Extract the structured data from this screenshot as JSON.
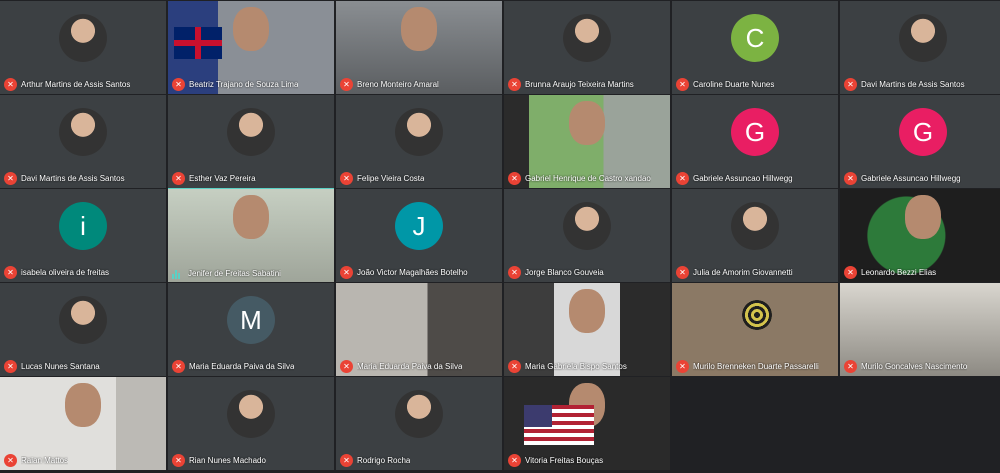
{
  "participants": [
    {
      "name": "Arthur Martins de Assis Santos",
      "kind": "photo"
    },
    {
      "name": "Beatriz Trajano de Souza Lima",
      "kind": "video",
      "scene": "s-flag s-face"
    },
    {
      "name": "Breno Monteiro Amaral",
      "kind": "video",
      "scene": "s-room s-face"
    },
    {
      "name": "Brunna Araujo Teixeira Martins",
      "kind": "photo"
    },
    {
      "name": "Caroline Duarte Nunes",
      "kind": "letter",
      "letter": "C",
      "color": "#7cb342"
    },
    {
      "name": "Davi Martins de Assis Santos",
      "kind": "photo"
    },
    {
      "name": "Davi Martins de Assis Santos",
      "kind": "photo"
    },
    {
      "name": "Esther Vaz Pereira",
      "kind": "photo"
    },
    {
      "name": "Felipe Vieira Costa",
      "kind": "photo"
    },
    {
      "name": "Gabriel Henrique de Castro xandao",
      "kind": "video",
      "scene": "s-green s-face"
    },
    {
      "name": "Gabriele Assuncao Hillwegg",
      "kind": "letter",
      "letter": "G",
      "color": "#e91e63"
    },
    {
      "name": "Gabriele Assuncao Hillwegg",
      "kind": "letter",
      "letter": "G",
      "color": "#e91e63"
    },
    {
      "name": "isabela oliveira de freitas",
      "kind": "letter",
      "letter": "i",
      "color": "#00897b"
    },
    {
      "name": "Jenifer de Freitas Sabatini",
      "kind": "video",
      "scene": "s-teal s-face",
      "speaking": true
    },
    {
      "name": "João Victor Magalhães Botelho",
      "kind": "letter",
      "letter": "J",
      "color": "#0097a7"
    },
    {
      "name": "Jorge Blanco Gouveia",
      "kind": "photo"
    },
    {
      "name": "Julia de Amorim Giovannetti",
      "kind": "photo"
    },
    {
      "name": "Leonardo Bezzi Elias",
      "kind": "video",
      "scene": "s-gaming s-face"
    },
    {
      "name": "Lucas Nunes Santana",
      "kind": "photo"
    },
    {
      "name": "Maria Eduarda Paiva da Silva",
      "kind": "letter",
      "letter": "M",
      "color": "#455a64"
    },
    {
      "name": "Maria Eduarda Paiva da Silva",
      "kind": "video",
      "scene": "s-dim"
    },
    {
      "name": "Maria Gabriela Bispo Santos",
      "kind": "video",
      "scene": "s-white s-face"
    },
    {
      "name": "Murilo Brenneken Duarte Passarelli",
      "kind": "video",
      "scene": "s-target"
    },
    {
      "name": "Murilo Goncalves Nascimento",
      "kind": "video",
      "scene": "s-corner"
    },
    {
      "name": "Raian Mattos",
      "kind": "video",
      "scene": "s-head s-face"
    },
    {
      "name": "Rian Nunes Machado",
      "kind": "photo"
    },
    {
      "name": "Rodrigo Rocha",
      "kind": "photo"
    },
    {
      "name": "Vitoria Freitas Bouças",
      "kind": "video",
      "scene": "s-usa s-face"
    }
  ]
}
